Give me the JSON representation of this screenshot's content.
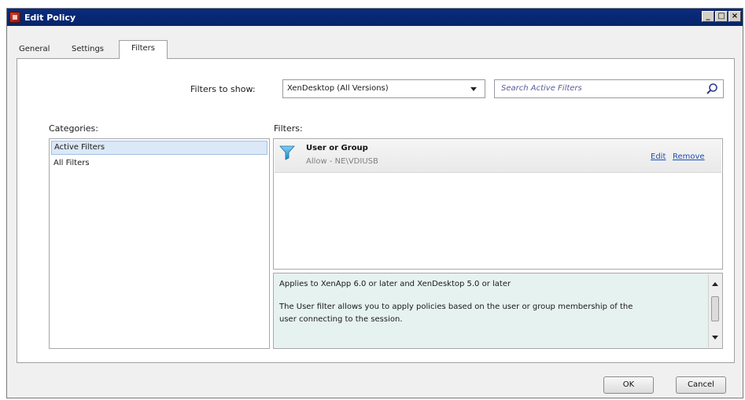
{
  "window": {
    "title": "Edit Policy",
    "controls": {
      "minimize": "_",
      "maximize": "□",
      "close": "×"
    }
  },
  "tabs": [
    {
      "label": "General"
    },
    {
      "label": "Settings"
    },
    {
      "label": "Filters",
      "active": true
    }
  ],
  "filters_to_show": {
    "label": "Filters to show:",
    "value": "XenDesktop (All Versions)"
  },
  "search": {
    "placeholder": "Search Active Filters",
    "icon": "search-icon"
  },
  "categories": {
    "label": "Categories:",
    "items": [
      {
        "label": "Active Filters",
        "selected": true
      },
      {
        "label": "All Filters",
        "selected": false
      }
    ]
  },
  "filters": {
    "label": "Filters:",
    "items": [
      {
        "name": "User or Group",
        "detail": "Allow - NE\\VDIUSB",
        "edit_label": "Edit",
        "remove_label": "Remove",
        "icon": "funnel-icon"
      }
    ]
  },
  "description": {
    "line1": "Applies to XenApp 6.0 or later and XenDesktop 5.0 or later",
    "line2": "The User filter allows you to apply policies based on the user or group membership of the",
    "line3": "user connecting to the session."
  },
  "buttons": {
    "ok": "OK",
    "cancel": "Cancel"
  },
  "colors": {
    "titlebar": "#0a2c7e",
    "selection": "#dbe8f7",
    "link": "#1f4fb0",
    "description_bg": "#e6f2f0"
  }
}
